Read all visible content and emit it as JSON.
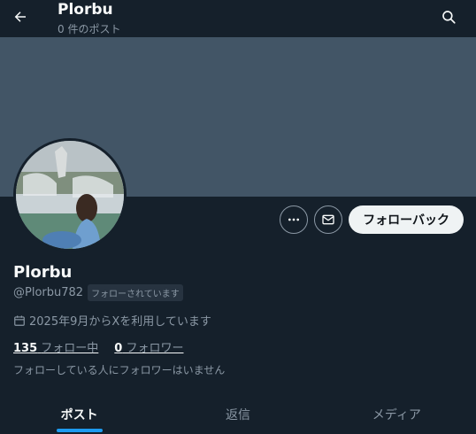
{
  "header": {
    "title": "Plorbu",
    "subtitle": "0 件のポスト",
    "back_icon": "arrow-left-icon",
    "search_icon": "search-icon"
  },
  "profile": {
    "display_name": "Plorbu",
    "handle": "@Plorbu782",
    "follows_you_badge": "フォローされています",
    "joined": "2025年9月からXを利用しています",
    "following_count": "135",
    "following_label": "フォロー中",
    "followers_count": "0",
    "followers_label": "フォロワー",
    "mutuals_note": "フォローしている人にフォロワーはいません"
  },
  "actions": {
    "more_icon": "more-horizontal-icon",
    "message_icon": "envelope-icon",
    "follow_back_label": "フォローバック"
  },
  "tabs": [
    {
      "label": "ポスト",
      "active": true
    },
    {
      "label": "返信",
      "active": false
    },
    {
      "label": "メディア",
      "active": false
    }
  ],
  "colors": {
    "background": "#15202b",
    "banner": "#425566",
    "accent": "#1d9bf0",
    "muted_text": "#8b98a5"
  }
}
